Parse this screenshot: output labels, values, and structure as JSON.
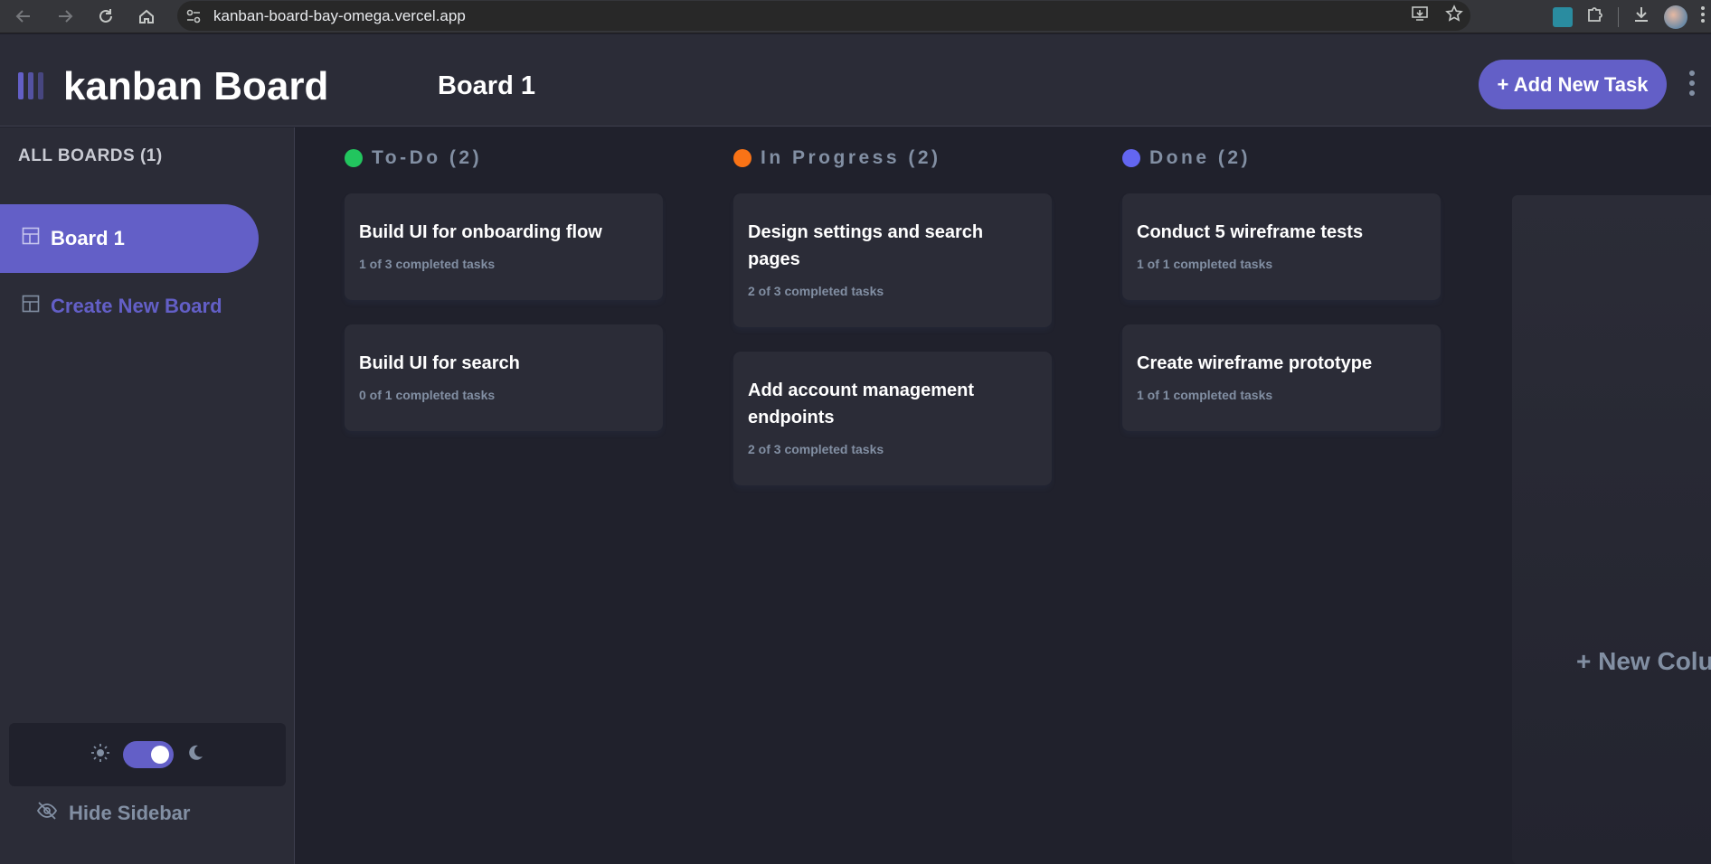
{
  "browser": {
    "url": "kanban-board-bay-omega.vercel.app"
  },
  "header": {
    "app_title": "kanban Board",
    "board_title": "Board 1",
    "add_task_label": "+ Add New Task"
  },
  "sidebar": {
    "all_boards_label": "ALL BOARDS (1)",
    "boards": [
      {
        "label": "Board 1"
      }
    ],
    "create_board_label": "Create New Board",
    "hide_sidebar_label": "Hide Sidebar",
    "theme_dark": true
  },
  "columns": [
    {
      "name": "To-Do (2)",
      "color": "#22c55e",
      "tasks": [
        {
          "title": "Build UI for onboarding flow",
          "subtasks": "1 of 3 completed tasks"
        },
        {
          "title": "Build UI for search",
          "subtasks": "0 of 1 completed tasks"
        }
      ]
    },
    {
      "name": "In Progress (2)",
      "color": "#f97316",
      "tasks": [
        {
          "title": "Design settings and search pages",
          "subtasks": "2 of 3 completed tasks"
        },
        {
          "title": "Add account management endpoints",
          "subtasks": "2 of 3 completed tasks"
        }
      ]
    },
    {
      "name": "Done (2)",
      "color": "#6366f1",
      "tasks": [
        {
          "title": "Conduct 5 wireframe tests",
          "subtasks": "1 of 1 completed tasks"
        },
        {
          "title": "Create wireframe prototype",
          "subtasks": "1 of 1 completed tasks"
        }
      ]
    }
  ],
  "new_column_label": "+ New Column",
  "colors": {
    "accent": "#635fc7",
    "background": "#20212c",
    "surface": "#2b2c37",
    "muted_text": "#828fa3"
  },
  "icons": [
    "back-arrow-icon",
    "forward-arrow-icon",
    "reload-icon",
    "home-icon",
    "site-settings-icon",
    "install-app-icon",
    "bookmark-star-icon",
    "extension-icon",
    "puzzle-icon",
    "download-icon",
    "profile-avatar",
    "menu-icon",
    "logo-icon",
    "board-icon",
    "sun-icon",
    "moon-icon",
    "eye-slash-icon",
    "kebab-menu-icon"
  ]
}
